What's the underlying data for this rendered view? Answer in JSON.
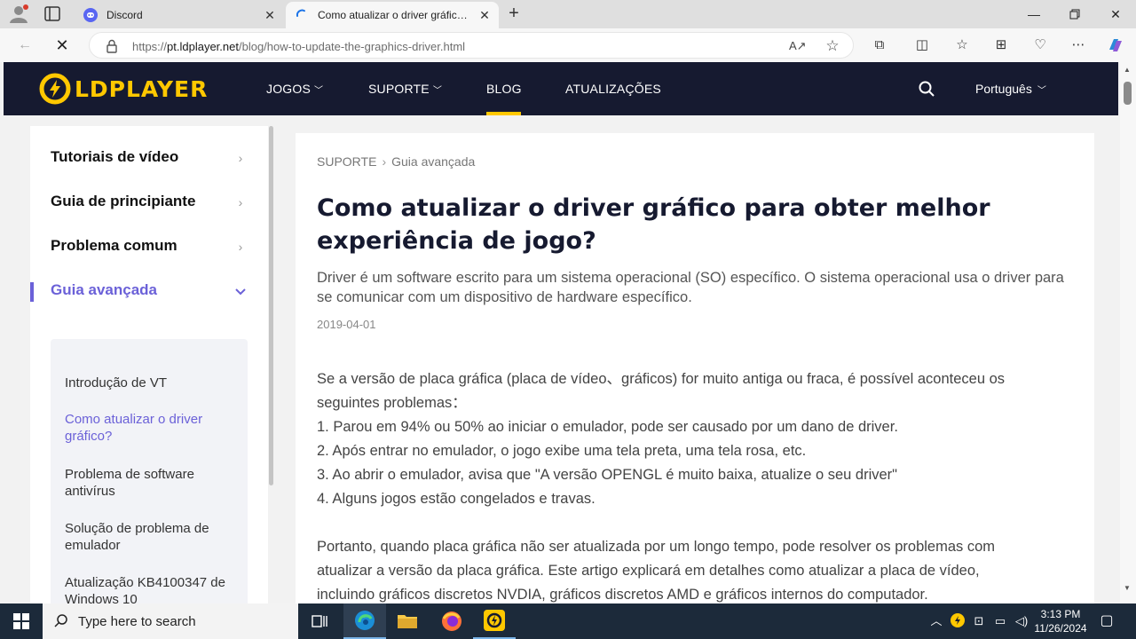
{
  "browser": {
    "tabs": [
      {
        "title": "Discord",
        "icon": "discord-icon"
      },
      {
        "title": "Como atualizar o driver gráfico para obter melhor experiência de jogo?",
        "icon": "loading-spinner-icon"
      }
    ],
    "address": {
      "scheme": "https://",
      "host": "pt.ldplayer.net",
      "path": "/blog/how-to-update-the-graphics-driver.html"
    }
  },
  "site": {
    "logo_text": "LDPLAYER",
    "brand_color": "#ffc800",
    "nav": {
      "jogos": "JOGOS",
      "suporte": "SUPORTE",
      "blog": "BLOG",
      "atualizacoes": "ATUALIZAÇÕES"
    },
    "language": "Português"
  },
  "sidebar": {
    "items": [
      {
        "label": "Tutoriais de vídeo"
      },
      {
        "label": "Guia de principiante"
      },
      {
        "label": "Problema comum"
      },
      {
        "label": "Guia avançada"
      }
    ],
    "subitems": [
      {
        "label": "Introdução de VT"
      },
      {
        "label": "Como atualizar o driver gráfico?"
      },
      {
        "label": "Problema de software antivírus"
      },
      {
        "label": "Solução de problema de emulador"
      },
      {
        "label": "Atualização KB4100347 de Windows 10"
      }
    ],
    "accent_color": "#6b61d8"
  },
  "article": {
    "breadcrumb": {
      "root": "SUPORTE",
      "current": "Guia avançada"
    },
    "title": "Como atualizar o driver gráfico para obter melhor experiência de jogo?",
    "summary": "Driver é um software escrito para um sistema operacional (SO) específico. O sistema operacional usa o driver para se comunicar com um dispositivo de hardware específico.",
    "date": "2019-04-01",
    "body": [
      "Se a versão de placa gráfica (placa de vídeo、gráficos) for muito antiga ou fraca, é possível aconteceu os seguintes problemas：",
      "1. Parou em 94% ou 50% ao iniciar o emulador, pode ser causado por um dano de driver.",
      "2. Após entrar no emulador, o jogo exibe uma tela preta, uma tela rosa, etc.",
      "3. Ao abrir o emulador, avisa que \"A versão OPENGL é muito baixa, atualize o seu driver\"",
      "4. Alguns jogos estão congelados e travas.",
      "Portanto, quando placa gráfica não ser atualizada por um longo tempo, pode resolver os problemas com atualizar a versão da placa gráfica. Este artigo explicará em detalhes como atualizar a placa de vídeo, incluindo gráficos discretos NVDIA, gráficos discretos AMD e gráficos internos do computador."
    ]
  },
  "taskbar": {
    "search_placeholder": "Type here to search",
    "time": "3:13 PM",
    "date": "11/26/2024"
  }
}
